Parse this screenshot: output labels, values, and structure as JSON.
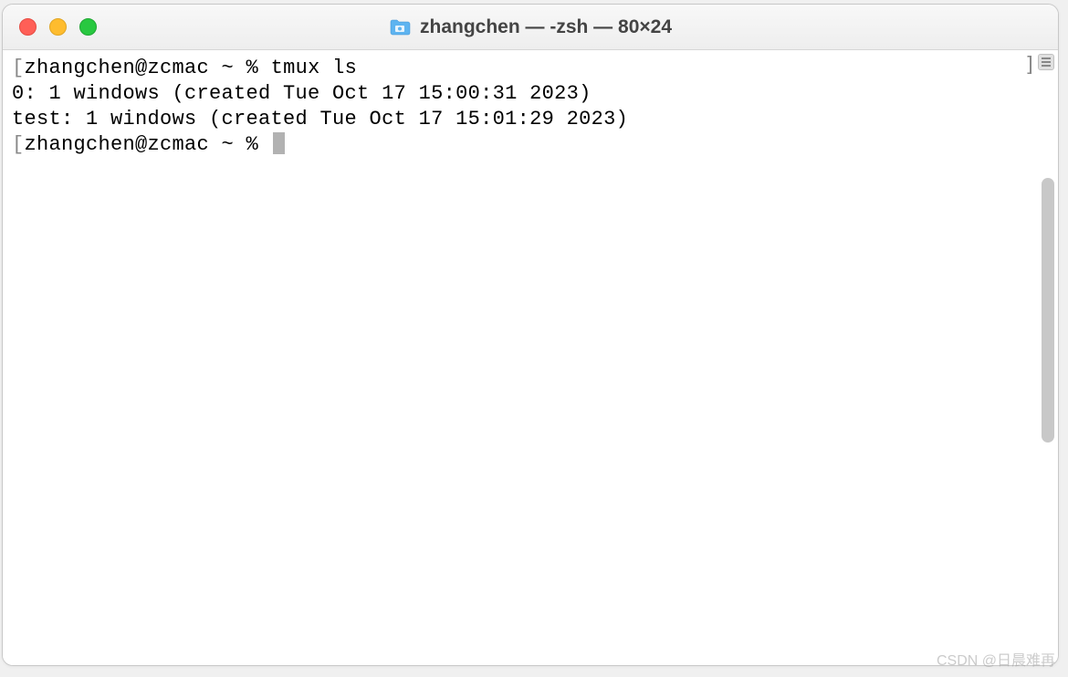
{
  "window": {
    "title": "zhangchen — -zsh — 80×24"
  },
  "terminal": {
    "lines": [
      {
        "bracket_open": "[",
        "prompt": "zhangchen@zcmac ~ % ",
        "command": "tmux ls"
      },
      {
        "output": "0: 1 windows (created Tue Oct 17 15:00:31 2023)"
      },
      {
        "output": "test: 1 windows (created Tue Oct 17 15:01:29 2023)"
      },
      {
        "bracket_open": "[",
        "prompt": "zhangchen@zcmac ~ % ",
        "cursor": true
      }
    ],
    "right_bracket": "]"
  },
  "watermark": "CSDN @日晨难再"
}
